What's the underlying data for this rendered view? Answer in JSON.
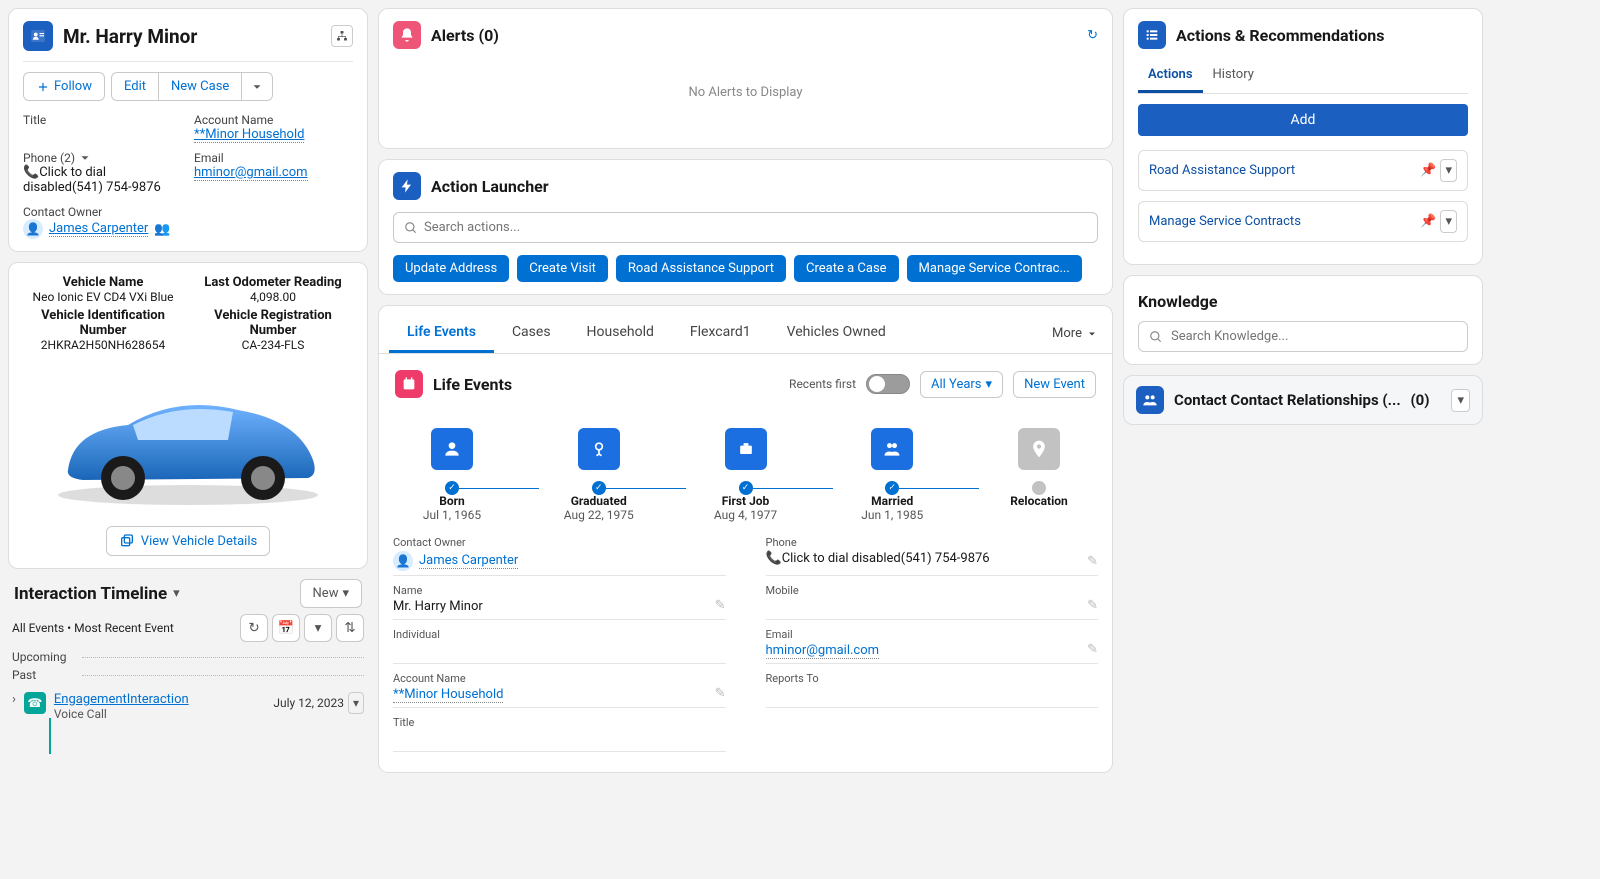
{
  "contact": {
    "name": "Mr. Harry Minor",
    "buttons": {
      "follow": "Follow",
      "edit": "Edit",
      "newcase": "New Case"
    },
    "fields": {
      "title_label": "Title",
      "title_val": "",
      "account_label": "Account Name",
      "account_val": "**Minor Household",
      "phone_label": "Phone (2)",
      "phone_val": "Click to dial disabled(541) 754-9876",
      "email_label": "Email",
      "email_val": "hminor@gmail.com",
      "owner_label": "Contact Owner",
      "owner_val": "James Carpenter"
    }
  },
  "vehicle": {
    "name_label": "Vehicle Name",
    "name_val": "Neo Ionic EV CD4 VXi Blue",
    "odo_label": "Last Odometer Reading",
    "odo_val": "4,098.00",
    "vin_label": "Vehicle Identification Number",
    "vin_val": "2HKRA2H50NH628654",
    "reg_label": "Vehicle Registration Number",
    "reg_val": "CA-234-FLS",
    "view_btn": "View Vehicle Details"
  },
  "timeline": {
    "title": "Interaction Timeline",
    "new_btn": "New",
    "subline": "All Events • Most Recent Event",
    "upcoming": "Upcoming",
    "past": "Past",
    "event_title": "EngagementInteraction",
    "event_sub": "Voice Call",
    "event_date": "July 12, 2023"
  },
  "alerts": {
    "title": "Alerts (0)",
    "empty": "No Alerts to Display"
  },
  "launcher": {
    "title": "Action Launcher",
    "placeholder": "Search actions...",
    "chips": {
      "a": "Update Address",
      "b": "Create Visit",
      "c": "Road Assistance Support",
      "d": "Create a Case",
      "e": "Manage Service Contrac..."
    }
  },
  "tabs": {
    "life": "Life Events",
    "cases": "Cases",
    "household": "Household",
    "flex": "Flexcard1",
    "vehicles": "Vehicles Owned",
    "more": "More"
  },
  "life": {
    "title": "Life Events",
    "recents": "Recents first",
    "all_years": "All Years",
    "new_event": "New Event",
    "events": {
      "e0": {
        "t": "Born",
        "d": "Jul 1, 1965"
      },
      "e1": {
        "t": "Graduated",
        "d": "Aug 22, 1975"
      },
      "e2": {
        "t": "First Job",
        "d": "Aug 4, 1977"
      },
      "e3": {
        "t": "Married",
        "d": "Jun 1, 1985"
      },
      "e4": {
        "t": "Relocation",
        "d": ""
      }
    }
  },
  "details": {
    "owner_label": "Contact Owner",
    "owner_val": "James Carpenter",
    "phone_label": "Phone",
    "phone_val": "Click to dial disabled(541) 754-9876",
    "name_label": "Name",
    "name_val": "Mr. Harry Minor",
    "mobile_label": "Mobile",
    "mobile_val": "",
    "indiv_label": "Individual",
    "indiv_val": "",
    "email_label": "Email",
    "email_val": "hminor@gmail.com",
    "account_label": "Account Name",
    "account_val": "**Minor Household",
    "reports_label": "Reports To",
    "reports_val": "",
    "title_label": "Title",
    "title_val": ""
  },
  "actions": {
    "title": "Actions & Recommendations",
    "tab_actions": "Actions",
    "tab_history": "History",
    "add": "Add",
    "rec1": "Road Assistance Support",
    "rec2": "Manage Service Contracts"
  },
  "knowledge": {
    "title": "Knowledge",
    "placeholder": "Search Knowledge..."
  },
  "related": {
    "title": "Contact Contact Relationships (...",
    "count": "(0)"
  }
}
